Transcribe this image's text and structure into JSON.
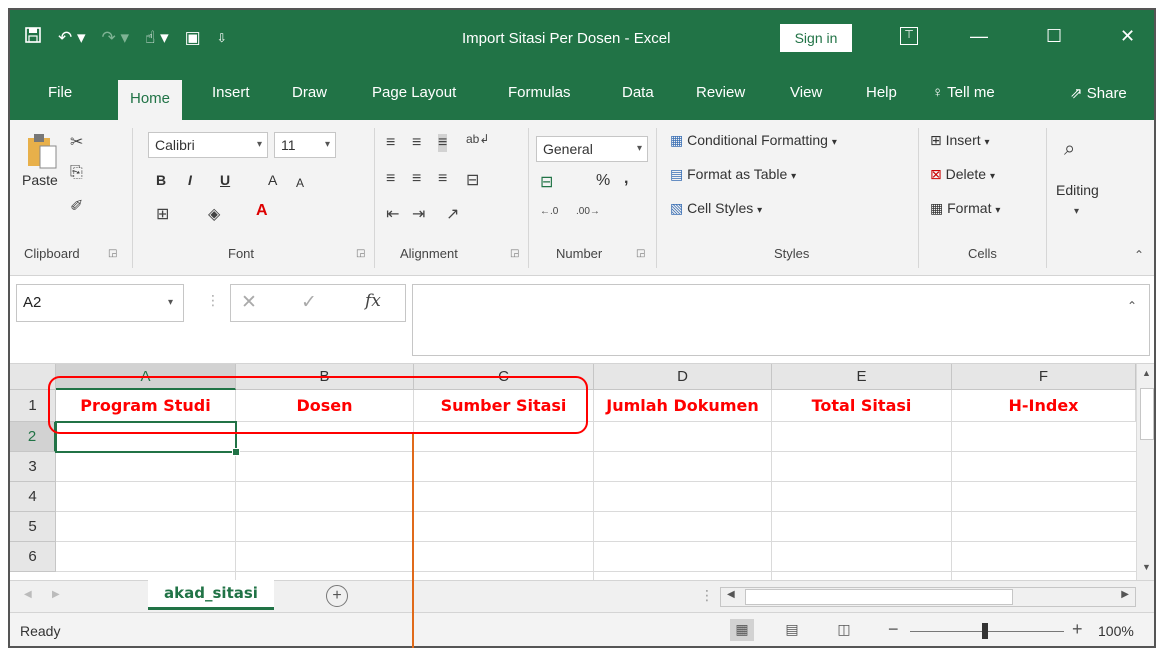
{
  "window": {
    "title": "Import Sitasi Per Dosen  -  Excel",
    "sign_in": "Sign in",
    "controls": {
      "ribbon_display_icon": "ribbon-display-icon",
      "minimize": "—",
      "maximize": "☐",
      "close": "✕"
    }
  },
  "quick_access": {
    "save_icon": "save-icon",
    "undo_icon": "undo-icon",
    "redo_icon": "redo-icon",
    "touch_mode_icon": "touch-mode-icon",
    "camera_icon": "camera-icon",
    "customize_icon": "customize-qat-icon"
  },
  "tabs": [
    "File",
    "Home",
    "Insert",
    "Draw",
    "Page Layout",
    "Formulas",
    "Data",
    "Review",
    "View",
    "Help"
  ],
  "active_tab": "Home",
  "tell_me": "Tell me",
  "share": "Share",
  "ribbon": {
    "clipboard": {
      "paste": "Paste",
      "label": "Clipboard"
    },
    "font": {
      "name": "Calibri",
      "size": "11",
      "label": "Font",
      "bold": "B",
      "italic": "I",
      "underline": "U",
      "grow": "A",
      "shrink": "A"
    },
    "alignment": {
      "label": "Alignment"
    },
    "number": {
      "format": "General",
      "percent": "%",
      "comma": ",",
      "label": "Number"
    },
    "styles": {
      "conditional": "Conditional Formatting",
      "format_table": "Format as Table",
      "cell_styles": "Cell Styles",
      "label": "Styles"
    },
    "cells": {
      "insert": "Insert",
      "delete": "Delete",
      "format": "Format",
      "label": "Cells"
    },
    "editing": {
      "label": "Editing"
    }
  },
  "formula_bar": {
    "name_box": "A2",
    "fx": "fx",
    "cancel": "✕",
    "enter": "✓",
    "value": ""
  },
  "grid": {
    "columns": [
      "A",
      "B",
      "C",
      "D",
      "E",
      "F"
    ],
    "rows": [
      "1",
      "2",
      "3",
      "4",
      "5",
      "6"
    ],
    "row1": [
      "Program Studi",
      "Dosen",
      "Sumber Sitasi",
      "Jumlah Dokumen",
      "Total Sitasi",
      "H-Index"
    ],
    "active_cell": "A2",
    "header_text_color": "#ff0000"
  },
  "sheets": {
    "tabs": [
      "akad_sitasi"
    ],
    "active": "akad_sitasi",
    "add": "+"
  },
  "status": {
    "text": "Ready",
    "zoom": "100%",
    "zoom_minus": "−",
    "zoom_plus": "+"
  },
  "colors": {
    "excel_green": "#217346",
    "annotation_red": "#ff0000",
    "annotation_orange": "#e06a1a"
  }
}
